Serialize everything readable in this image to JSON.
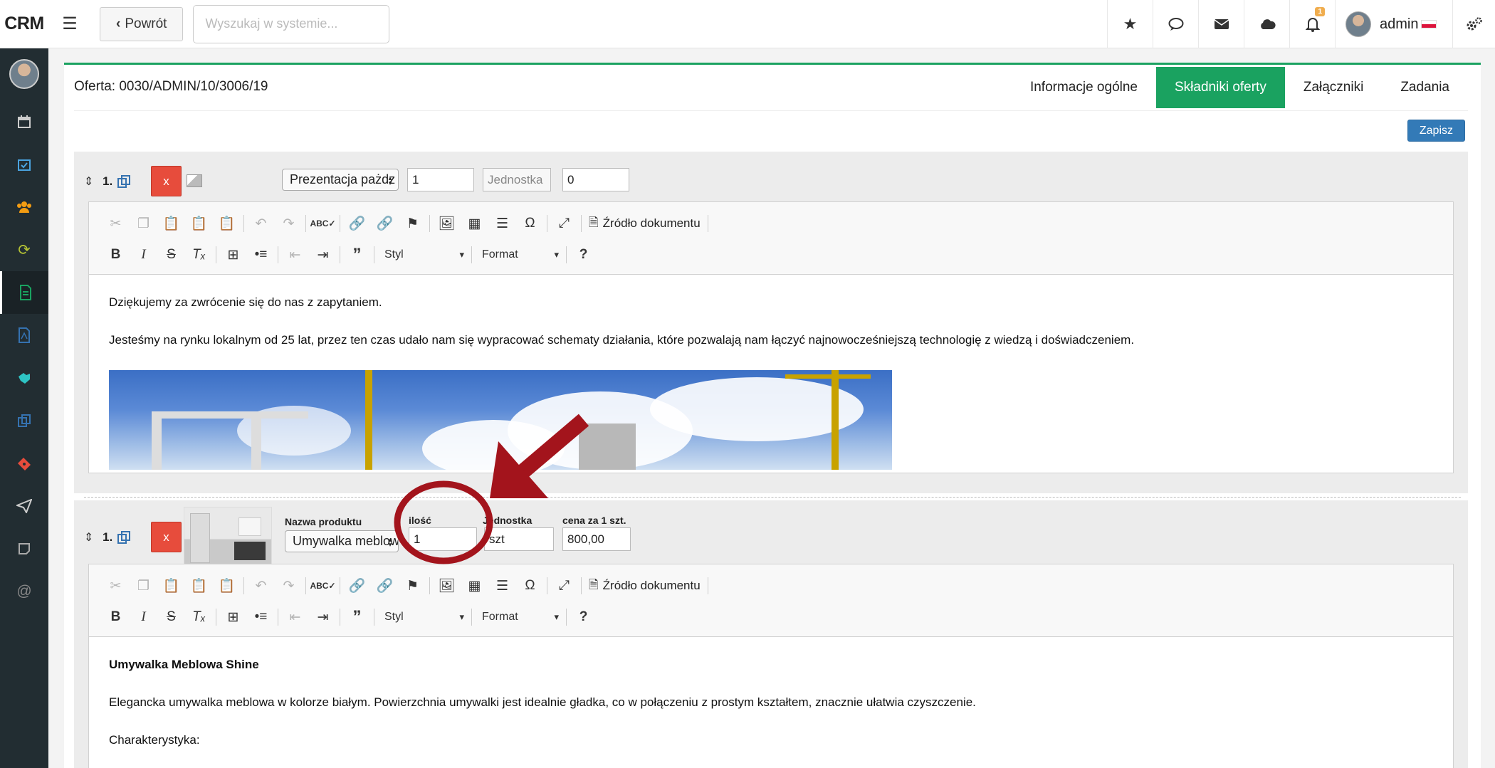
{
  "app": {
    "brand": "CRM"
  },
  "topbar": {
    "back_label": "Powrót",
    "search_placeholder": "Wyszukaj w systemie...",
    "notification_count": "1",
    "user_name": "admin"
  },
  "offer": {
    "title": "Oferta: 0030/ADMIN/10/3006/19",
    "save_label": "Zapisz",
    "tabs": [
      {
        "label": "Informacje ogólne",
        "active": false
      },
      {
        "label": "Składniki oferty",
        "active": true
      },
      {
        "label": "Załączniki",
        "active": false
      },
      {
        "label": "Zadania",
        "active": false
      }
    ]
  },
  "items": [
    {
      "number": "1.",
      "delete_label": "x",
      "product": "Prezentacja pażdz",
      "quantity": "1",
      "unit_placeholder": "Jednostka",
      "price": "0",
      "editor": {
        "source_label": "Źródło dokumentu",
        "style_label": "Styl",
        "format_label": "Format",
        "help_label": "?",
        "paragraphs": [
          "Dziękujemy za zwrócenie się do nas z zapytaniem.",
          "Jesteśmy na rynku lokalnym od 25 lat, przez ten czas udało nam się wypracować schematy działania, które pozwalają nam łączyć najnowocześniejszą technologię z wiedzą i doświadczeniem."
        ]
      }
    },
    {
      "number": "1.",
      "delete_label": "x",
      "labels": {
        "product": "Nazwa produktu",
        "quantity": "ilość",
        "unit": "Jednostka",
        "price": "cena za 1 szt."
      },
      "product": "Umywalka meblowa",
      "quantity": "1",
      "unit": "szt",
      "price": "800,00",
      "editor": {
        "source_label": "Źródło dokumentu",
        "style_label": "Styl",
        "format_label": "Format",
        "help_label": "?",
        "heading": "Umywalka Meblowa Shine",
        "paragraphs": [
          "Elegancka umywalka meblowa w kolorze białym. Powierzchnia umywalki jest idealnie gładka, co w połączeniu z prostym kształtem, znacznie ułatwia czyszczenie.",
          "Charakterystyka:"
        ]
      }
    }
  ],
  "colors": {
    "accent": "#1aa260",
    "danger": "#e74c3c",
    "primary": "#337ab7",
    "sidebar": "#222d32",
    "annotation": "#a3141c"
  }
}
